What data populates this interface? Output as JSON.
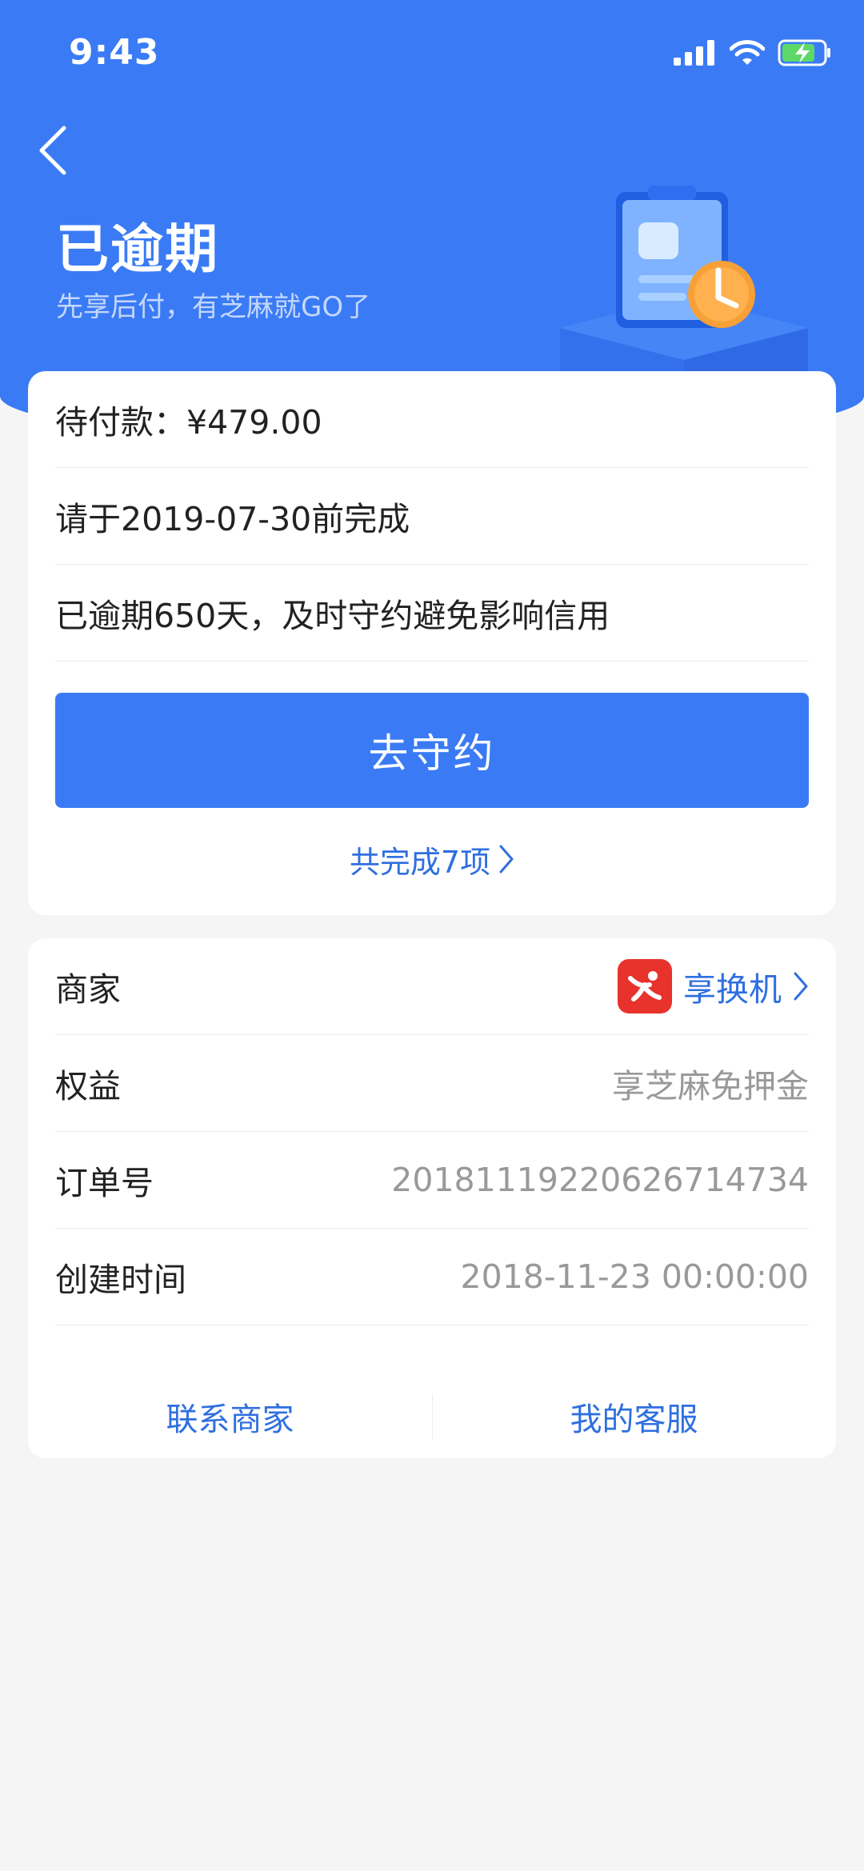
{
  "status_bar": {
    "time": "9:43"
  },
  "header": {
    "title": "已逾期",
    "subtitle": "先享后付，有芝麻就GO了"
  },
  "payment": {
    "amount_label": "待付款：¥479.00",
    "deadline": "请于2019-07-30前完成",
    "overdue_notice": "已逾期650天，及时守约避免影响信用",
    "action_button": "去守约",
    "completed_link": "共完成7项"
  },
  "details": {
    "merchant_label": "商家",
    "merchant_name": "享换机",
    "benefit_label": "权益",
    "benefit_value": "享芝麻免押金",
    "order_label": "订单号",
    "order_value": "2018111922062671473​4",
    "created_label": "创建时间",
    "created_value": "2018-11-23 00:00:00"
  },
  "actions": {
    "contact_merchant": "联系商家",
    "customer_service": "我的客服"
  },
  "colors": {
    "brand_blue": "#3a7bf5",
    "link_blue": "#2f6fe0",
    "merchant_red": "#e8322c",
    "clock_orange": "#f6a037"
  }
}
